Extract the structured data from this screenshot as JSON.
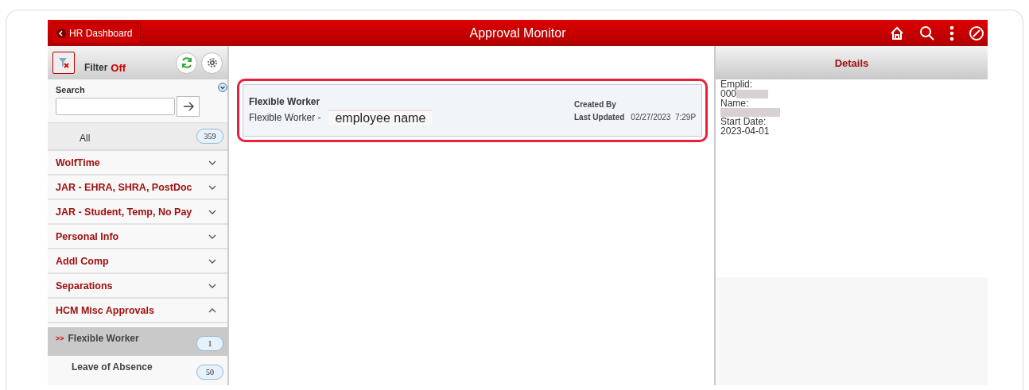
{
  "header": {
    "back_label": "HR Dashboard",
    "title": "Approval Monitor"
  },
  "filter": {
    "label": "Filter",
    "state": "Off",
    "on": false
  },
  "search": {
    "label": "Search"
  },
  "all": {
    "label": "All",
    "count": "359"
  },
  "groups": [
    {
      "label": "WolfTime",
      "expanded": false
    },
    {
      "label": "JAR - EHRA, SHRA, PostDoc",
      "expanded": false
    },
    {
      "label": "JAR - Student, Temp, No Pay",
      "expanded": false
    },
    {
      "label": "Personal Info",
      "expanded": false
    },
    {
      "label": "Addl Comp",
      "expanded": false
    },
    {
      "label": "Separations",
      "expanded": false
    },
    {
      "label": "HCM Misc Approvals",
      "expanded": true,
      "children": [
        {
          "label": "Flexible Worker",
          "marker": ">>",
          "count": "1",
          "selected": true
        },
        {
          "label": "Leave of Absence",
          "count": "50",
          "selected": false
        }
      ]
    }
  ],
  "card": {
    "title": "Flexible Worker",
    "subtitle": "Flexible Worker -",
    "name_note": "employee name",
    "created_label": "Created By",
    "updated_label": "Last Updated",
    "updated_value": "02/27/2023  7:29P",
    "highlighted": true
  },
  "details": {
    "title": "Details",
    "fields": [
      {
        "label": "Emplid:",
        "value": "000",
        "redacted": true
      },
      {
        "label": "Name:",
        "redacted": true
      },
      {
        "label": "Start Date:",
        "value": "2023-04-01"
      }
    ]
  }
}
